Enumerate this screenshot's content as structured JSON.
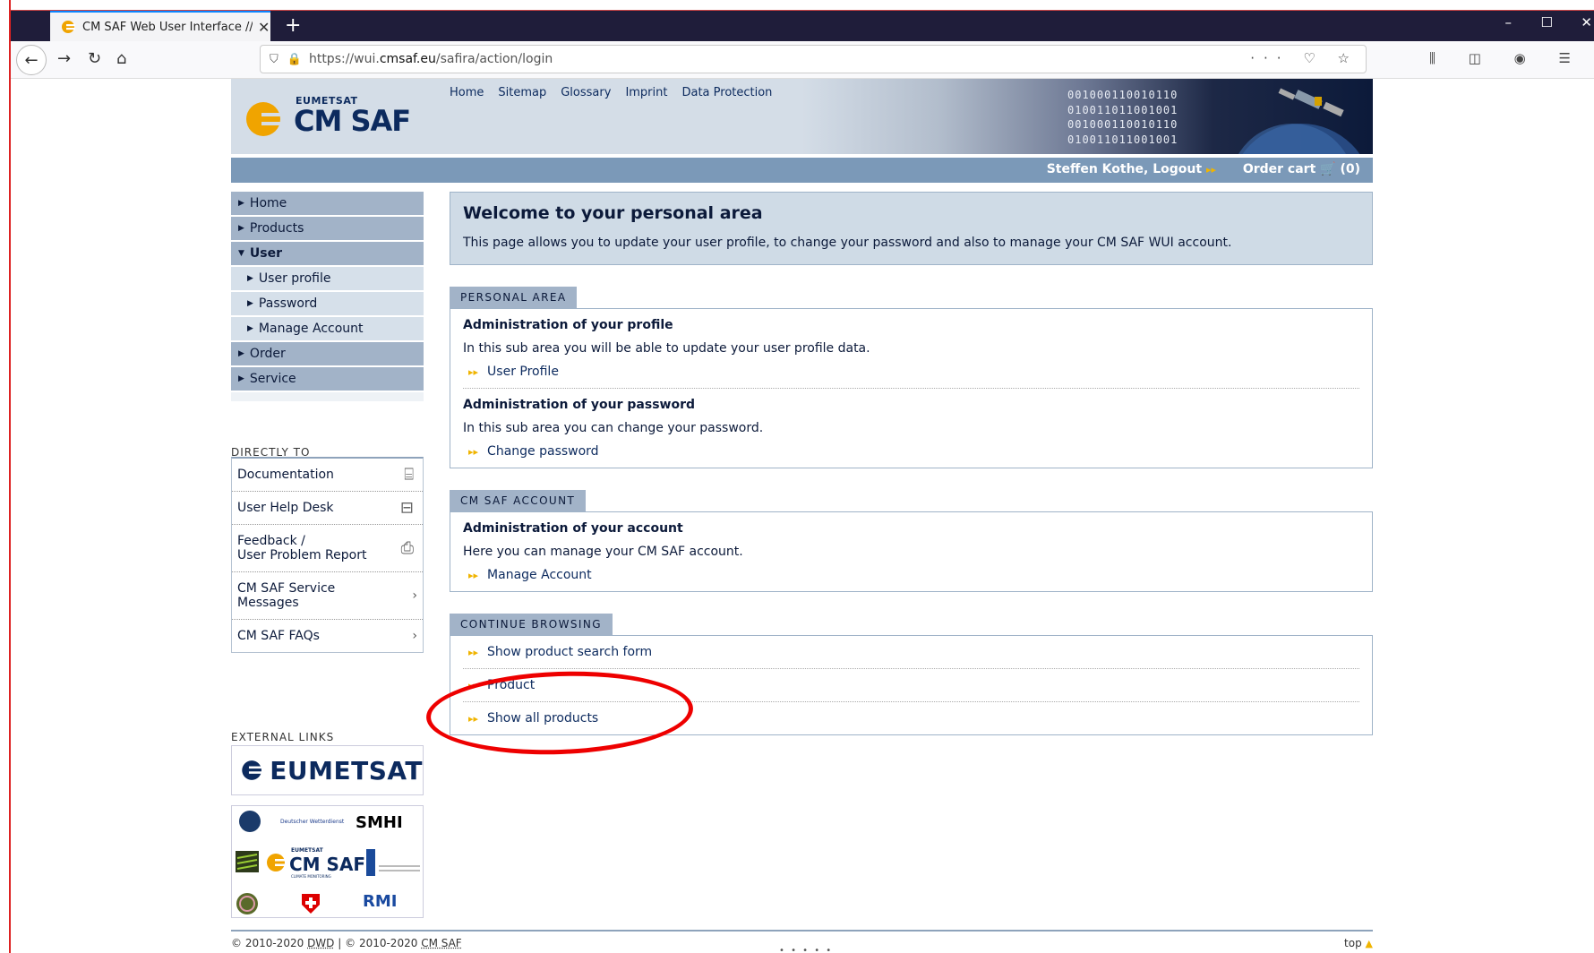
{
  "browser": {
    "tab_title": "CM SAF Web User Interface // L",
    "url_prefix": "https://wui.",
    "url_domain": "cmsaf.eu",
    "url_path": "/safira/action/login"
  },
  "header": {
    "logo_org": "EUMETSAT",
    "logo_name": "CM SAF",
    "nav": [
      "Home",
      "Sitemap",
      "Glossary",
      "Imprint",
      "Data Protection"
    ],
    "binary": [
      "001000110010110",
      "010011011001001",
      "001000110010110",
      "010011011001001"
    ]
  },
  "userbar": {
    "user_label": "Steffen Kothe, Logout",
    "cart_label": "Order cart",
    "cart_count": "(0)"
  },
  "leftmenu": {
    "items": [
      {
        "label": "Home"
      },
      {
        "label": "Products"
      },
      {
        "label": "User"
      },
      {
        "label": "User profile"
      },
      {
        "label": "Password"
      },
      {
        "label": "Manage Account"
      },
      {
        "label": "Order"
      },
      {
        "label": "Service"
      }
    ]
  },
  "directly": {
    "title": "DIRECTLY TO",
    "items": [
      {
        "label": "Documentation"
      },
      {
        "label": "User Help Desk"
      },
      {
        "label1": "Feedback /",
        "label2": "User Problem Report"
      },
      {
        "label1": "CM SAF Service",
        "label2": "Messages"
      },
      {
        "label": "CM SAF FAQs"
      }
    ]
  },
  "external": {
    "title": "EXTERNAL LINKS",
    "eumetsat": "EUMETSAT",
    "smhi": "SMHI",
    "cmsaf_org": "EUMETSAT",
    "cmsaf_name": "CM SAF",
    "cmsaf_sub": "CLIMATE MONITORING",
    "dwd": "Deutscher Wetterdienst",
    "rmi": "RMI"
  },
  "content": {
    "welcome_title": "Welcome to your personal area",
    "welcome_text": "This page allows you to update your user profile, to change your password and also to manage your CM SAF WUI account.",
    "personal_tab": "PERSONAL AREA",
    "profile_title": "Administration of your profile",
    "profile_text": "In this sub area you will be able to update your user profile data.",
    "profile_link": "User Profile",
    "password_title": "Administration of your password",
    "password_text": "In this sub area you can change your password.",
    "password_link": "Change password",
    "account_tab": "CM SAF ACCOUNT",
    "account_title": "Administration of your account",
    "account_text": "Here you can manage your CM SAF account.",
    "account_link": "Manage Account",
    "continue_tab": "CONTINUE BROWSING",
    "browse_links": [
      "Show product search form",
      "Product",
      "Show all products"
    ]
  },
  "footer": {
    "copyright1": "© 2010-2020",
    "dwd": "DWD",
    "sep": "|",
    "copyright2": "© 2010-2020",
    "cmsaf": "CM SAF",
    "top": "top"
  },
  "colors": {
    "annotation": "#e00000",
    "accent": "#f0b400",
    "navy": "#0c2a5e"
  }
}
